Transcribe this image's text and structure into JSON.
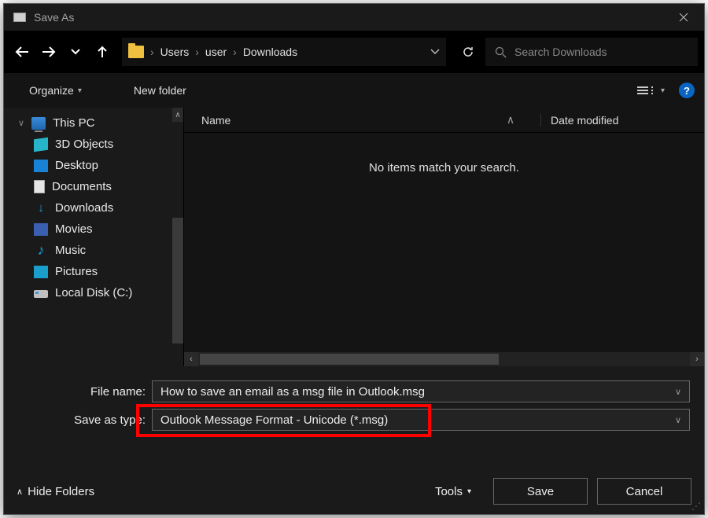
{
  "title": "Save As",
  "breadcrumb": {
    "p1": "Users",
    "p2": "user",
    "p3": "Downloads"
  },
  "search": {
    "placeholder": "Search Downloads"
  },
  "toolbar": {
    "organize": "Organize",
    "new_folder": "New folder"
  },
  "sidebar": {
    "root": "This PC",
    "items": [
      "3D Objects",
      "Desktop",
      "Documents",
      "Downloads",
      "Movies",
      "Music",
      "Pictures",
      "Local Disk (C:)"
    ]
  },
  "columns": {
    "name": "Name",
    "date": "Date modified"
  },
  "empty_msg": "No items match your search.",
  "form": {
    "filename_label": "File name:",
    "filename_value": "How to save an email as a msg file in Outlook.msg",
    "type_label": "Save as type:",
    "type_value": "Outlook Message Format - Unicode (*.msg)"
  },
  "footer": {
    "hide": "Hide Folders",
    "tools": "Tools",
    "save": "Save",
    "cancel": "Cancel"
  }
}
